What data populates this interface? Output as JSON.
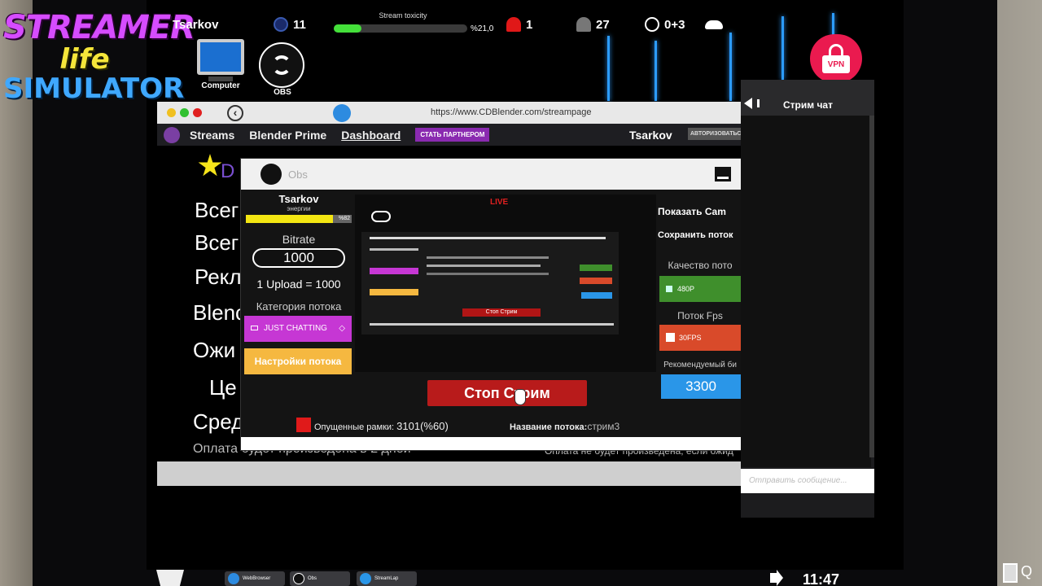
{
  "game_logo": {
    "line1": "STREAMER",
    "line2": "life",
    "line3": "SIMULATOR"
  },
  "hud": {
    "player_name": "Tsarkov",
    "level": "11",
    "toxicity_label": "Stream toxicity",
    "toxicity_value": "%21,0",
    "toxicity_fraction": 0.21,
    "alerts": "1",
    "viewers": "27",
    "time_bonus": "0+3"
  },
  "desktop_icons": [
    {
      "label": "Computer"
    },
    {
      "label": "OBS"
    }
  ],
  "vpn": {
    "label": "VPN",
    "color": "#ea1a4f"
  },
  "browser": {
    "url": "https://www.CDBlender.com/streampage",
    "nav": {
      "streams": "Streams",
      "blender_prime": "Blender Prime",
      "dashboard": "Dashboard",
      "partner": "СТАТЬ ПАРТНЕРОМ",
      "user": "Tsarkov",
      "auth": "АВТОРИЗОВАТЬСЯ"
    },
    "content_lines": [
      "D",
      "Всег",
      "Всег",
      "Рекл",
      "Blenc",
      "Ожи",
      "Це",
      "Сред"
    ],
    "footer_left": "Оплата будет произведена в 2 дней",
    "footer_right": "Оплата не будет произведена, если ожид"
  },
  "obs": {
    "title": "Obs",
    "username": "Tsarkov",
    "energy_label": "энергии",
    "energy_value": "%82",
    "energy_fraction": 0.82,
    "bitrate_label": "Bitrate",
    "bitrate_value": "1000",
    "upload_text": "1 Upload = 1000",
    "category_label": "Категория потока",
    "category_value": "JUST CHATTING",
    "settings_button": "Настройки потока",
    "show_cam": "Показать Cam",
    "save_stream": "Сохранить поток",
    "quality_label": "Качество пото",
    "quality_value": "480P",
    "fps_label": "Поток Fps",
    "fps_value": "30FPS",
    "recommended_label": "Рекомендуемый би",
    "recommended_value": "3300",
    "stop_button": "Стоп Стрим",
    "preview_stop": "Стоп Стрим",
    "preview_live": "LIVE",
    "dropped_label": "Опущенные рамки:",
    "dropped_value": "3101(%60)",
    "stream_name_label": "Название потока:",
    "stream_name_value": "стрим3"
  },
  "chat": {
    "title": "Стрим чат",
    "input_placeholder": "Отправить сообщение..."
  },
  "taskbar": {
    "items": [
      "WebBrowser",
      "Obs",
      "StreamLap"
    ],
    "clock": "11:47"
  }
}
